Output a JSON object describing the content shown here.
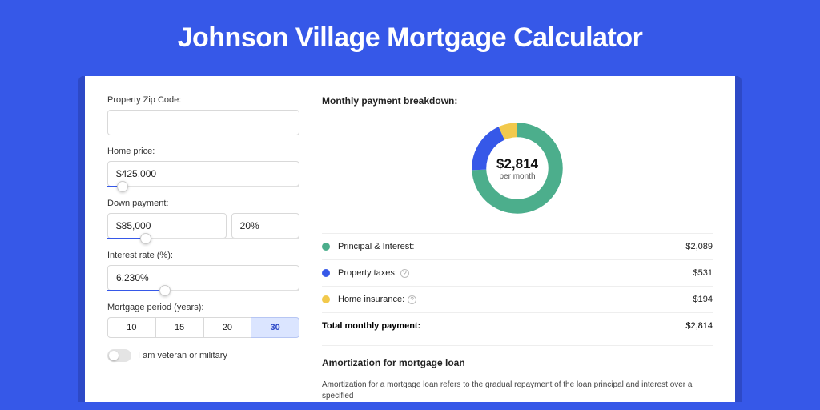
{
  "header": {
    "title": "Johnson Village Mortgage Calculator"
  },
  "form": {
    "zip": {
      "label": "Property Zip Code:",
      "value": ""
    },
    "home_price": {
      "label": "Home price:",
      "value": "$425,000",
      "slider_pct": 8
    },
    "down_payment": {
      "label": "Down payment:",
      "value": "$85,000",
      "pct": "20%",
      "slider_pct": 20
    },
    "interest_rate": {
      "label": "Interest rate (%):",
      "value": "6.230%",
      "slider_pct": 30
    },
    "period": {
      "label": "Mortgage period (years):",
      "options": [
        "10",
        "15",
        "20",
        "30"
      ],
      "active_index": 3
    },
    "veteran": {
      "label": "I am veteran or military",
      "on": false
    }
  },
  "breakdown": {
    "title": "Monthly payment breakdown:",
    "center_amount": "$2,814",
    "center_sub": "per month",
    "rows": [
      {
        "color": "green",
        "label": "Principal & Interest:",
        "value": "$2,089",
        "info": false
      },
      {
        "color": "blue",
        "label": "Property taxes:",
        "value": "$531",
        "info": true
      },
      {
        "color": "yellow",
        "label": "Home insurance:",
        "value": "$194",
        "info": true
      }
    ],
    "total_label": "Total monthly payment:",
    "total_value": "$2,814"
  },
  "amort": {
    "title": "Amortization for mortgage loan",
    "text": "Amortization for a mortgage loan refers to the gradual repayment of the loan principal and interest over a specified"
  },
  "chart_data": {
    "type": "pie",
    "title": "Monthly payment breakdown",
    "series": [
      {
        "name": "Principal & Interest",
        "value": 2089,
        "color": "#4cae8c"
      },
      {
        "name": "Property taxes",
        "value": 531,
        "color": "#3658e8"
      },
      {
        "name": "Home insurance",
        "value": 194,
        "color": "#f2c94c"
      }
    ],
    "total": 2814,
    "unit": "USD/month"
  }
}
